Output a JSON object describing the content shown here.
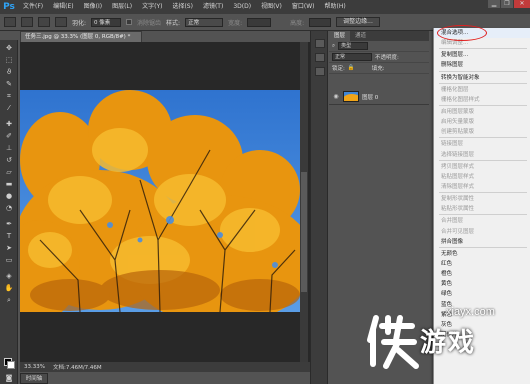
{
  "app": {
    "logo": "Ps"
  },
  "menubar": [
    "文件(F)",
    "编辑(E)",
    "图像(I)",
    "图层(L)",
    "文字(Y)",
    "选择(S)",
    "滤镜(T)",
    "3D(D)",
    "视图(V)",
    "窗口(W)",
    "帮助(H)"
  ],
  "window_controls": {
    "minimize": "▁",
    "restore": "❐",
    "close": "✕"
  },
  "options": {
    "feather_label": "羽化:",
    "feather_value": "0 像素",
    "antialias_label": "消除锯齿",
    "style_label": "样式:",
    "style_value": "正常",
    "width_label": "宽度:",
    "height_label": "高度:",
    "refine_button": "调整边缘..."
  },
  "document": {
    "tab_title": "任务三.jpg @ 33.3% (图层 0, RGB/8#) *",
    "zoom": "33.33%",
    "doc_info": "文档:7.46M/7.46M",
    "timeline_tab": "时间轴"
  },
  "layers_panel": {
    "tabs": [
      "图层",
      "通道"
    ],
    "filter_label": "类型",
    "blend_mode": "正常",
    "opacity_label": "不透明度:",
    "lock_label": "锁定:",
    "fill_label": "填充:",
    "layer_name": "图层 0"
  },
  "context_menu": {
    "items": [
      {
        "label": "混合选项...",
        "enabled": true,
        "highlight": true
      },
      {
        "label": "编辑调整...",
        "enabled": false
      },
      {
        "sep": true
      },
      {
        "label": "复制图层...",
        "enabled": true
      },
      {
        "label": "删除图层",
        "enabled": true
      },
      {
        "sep": true
      },
      {
        "label": "转换为智能对象",
        "enabled": true
      },
      {
        "sep": true
      },
      {
        "label": "栅格化图层",
        "enabled": false
      },
      {
        "label": "栅格化图层样式",
        "enabled": false
      },
      {
        "sep": true
      },
      {
        "label": "启用图层蒙版",
        "enabled": false
      },
      {
        "label": "启用矢量蒙版",
        "enabled": false
      },
      {
        "label": "创建剪贴蒙版",
        "enabled": false
      },
      {
        "sep": true
      },
      {
        "label": "链接图层",
        "enabled": false
      },
      {
        "label": "选择链接图层",
        "enabled": false
      },
      {
        "sep": true
      },
      {
        "label": "拷贝图层样式",
        "enabled": false
      },
      {
        "label": "粘贴图层样式",
        "enabled": false
      },
      {
        "label": "清除图层样式",
        "enabled": false
      },
      {
        "sep": true
      },
      {
        "label": "复制形状属性",
        "enabled": false
      },
      {
        "label": "粘贴形状属性",
        "enabled": false
      },
      {
        "sep": true
      },
      {
        "label": "合并图层",
        "enabled": false
      },
      {
        "label": "合并可见图层",
        "enabled": false
      },
      {
        "label": "拼合图像",
        "enabled": true
      },
      {
        "sep": true
      },
      {
        "label": "无颜色",
        "enabled": true
      },
      {
        "label": "红色",
        "enabled": true
      },
      {
        "label": "橙色",
        "enabled": true
      },
      {
        "label": "黄色",
        "enabled": true
      },
      {
        "label": "绿色",
        "enabled": true
      },
      {
        "label": "蓝色",
        "enabled": true
      },
      {
        "label": "紫色",
        "enabled": true
      },
      {
        "label": "灰色",
        "enabled": true
      },
      {
        "label": "明信片",
        "enabled": true
      }
    ]
  },
  "watermark": {
    "url": "xiayx.com",
    "text": "游戏"
  },
  "colors": {
    "accent": "#2fa3f6",
    "sky": "#3f86d6",
    "foliage": "#f0a418",
    "highlight_circle": "#e02020"
  }
}
